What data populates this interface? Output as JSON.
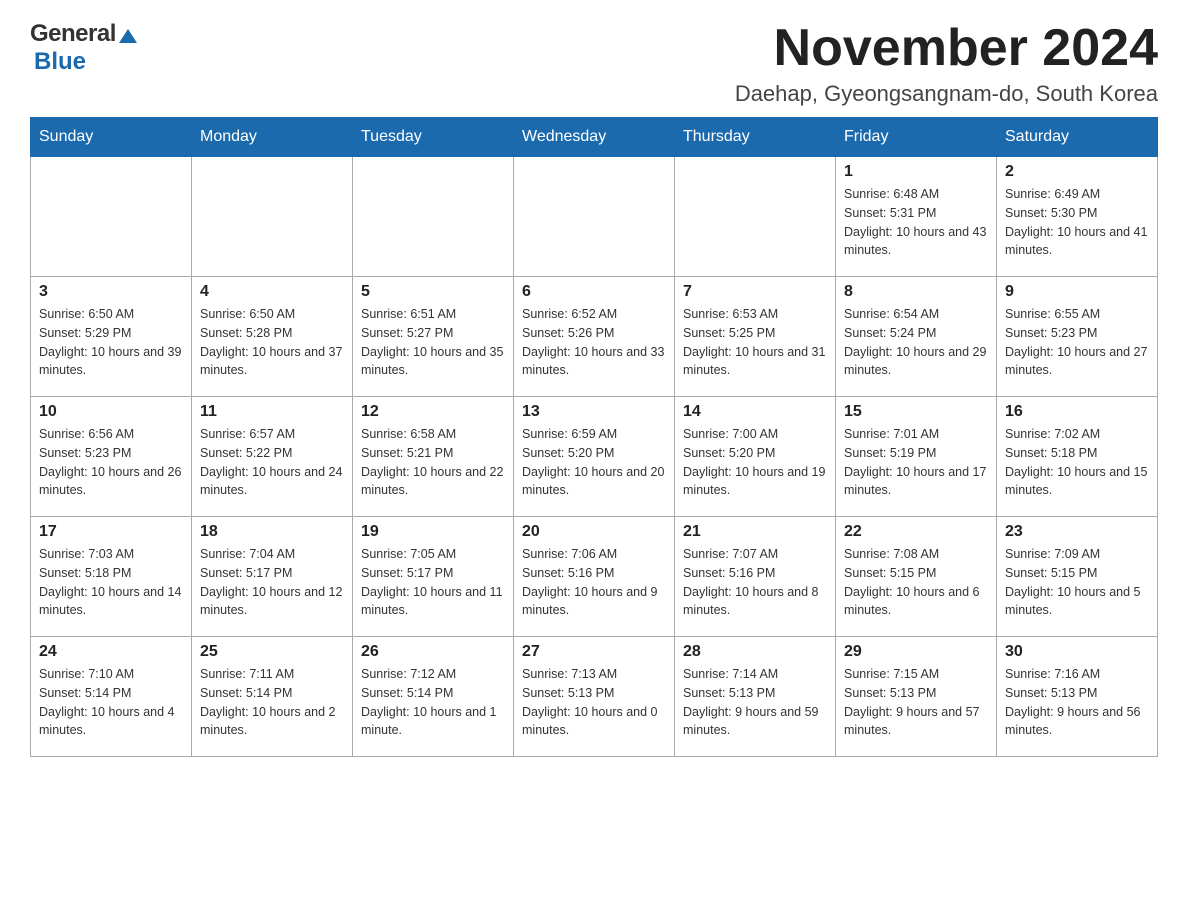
{
  "header": {
    "logo_general": "General",
    "logo_blue": "Blue",
    "title": "November 2024",
    "location": "Daehap, Gyeongsangnam-do, South Korea"
  },
  "days_of_week": [
    "Sunday",
    "Monday",
    "Tuesday",
    "Wednesday",
    "Thursday",
    "Friday",
    "Saturday"
  ],
  "weeks": [
    [
      {
        "day": "",
        "info": ""
      },
      {
        "day": "",
        "info": ""
      },
      {
        "day": "",
        "info": ""
      },
      {
        "day": "",
        "info": ""
      },
      {
        "day": "",
        "info": ""
      },
      {
        "day": "1",
        "info": "Sunrise: 6:48 AM\nSunset: 5:31 PM\nDaylight: 10 hours and 43 minutes."
      },
      {
        "day": "2",
        "info": "Sunrise: 6:49 AM\nSunset: 5:30 PM\nDaylight: 10 hours and 41 minutes."
      }
    ],
    [
      {
        "day": "3",
        "info": "Sunrise: 6:50 AM\nSunset: 5:29 PM\nDaylight: 10 hours and 39 minutes."
      },
      {
        "day": "4",
        "info": "Sunrise: 6:50 AM\nSunset: 5:28 PM\nDaylight: 10 hours and 37 minutes."
      },
      {
        "day": "5",
        "info": "Sunrise: 6:51 AM\nSunset: 5:27 PM\nDaylight: 10 hours and 35 minutes."
      },
      {
        "day": "6",
        "info": "Sunrise: 6:52 AM\nSunset: 5:26 PM\nDaylight: 10 hours and 33 minutes."
      },
      {
        "day": "7",
        "info": "Sunrise: 6:53 AM\nSunset: 5:25 PM\nDaylight: 10 hours and 31 minutes."
      },
      {
        "day": "8",
        "info": "Sunrise: 6:54 AM\nSunset: 5:24 PM\nDaylight: 10 hours and 29 minutes."
      },
      {
        "day": "9",
        "info": "Sunrise: 6:55 AM\nSunset: 5:23 PM\nDaylight: 10 hours and 27 minutes."
      }
    ],
    [
      {
        "day": "10",
        "info": "Sunrise: 6:56 AM\nSunset: 5:23 PM\nDaylight: 10 hours and 26 minutes."
      },
      {
        "day": "11",
        "info": "Sunrise: 6:57 AM\nSunset: 5:22 PM\nDaylight: 10 hours and 24 minutes."
      },
      {
        "day": "12",
        "info": "Sunrise: 6:58 AM\nSunset: 5:21 PM\nDaylight: 10 hours and 22 minutes."
      },
      {
        "day": "13",
        "info": "Sunrise: 6:59 AM\nSunset: 5:20 PM\nDaylight: 10 hours and 20 minutes."
      },
      {
        "day": "14",
        "info": "Sunrise: 7:00 AM\nSunset: 5:20 PM\nDaylight: 10 hours and 19 minutes."
      },
      {
        "day": "15",
        "info": "Sunrise: 7:01 AM\nSunset: 5:19 PM\nDaylight: 10 hours and 17 minutes."
      },
      {
        "day": "16",
        "info": "Sunrise: 7:02 AM\nSunset: 5:18 PM\nDaylight: 10 hours and 15 minutes."
      }
    ],
    [
      {
        "day": "17",
        "info": "Sunrise: 7:03 AM\nSunset: 5:18 PM\nDaylight: 10 hours and 14 minutes."
      },
      {
        "day": "18",
        "info": "Sunrise: 7:04 AM\nSunset: 5:17 PM\nDaylight: 10 hours and 12 minutes."
      },
      {
        "day": "19",
        "info": "Sunrise: 7:05 AM\nSunset: 5:17 PM\nDaylight: 10 hours and 11 minutes."
      },
      {
        "day": "20",
        "info": "Sunrise: 7:06 AM\nSunset: 5:16 PM\nDaylight: 10 hours and 9 minutes."
      },
      {
        "day": "21",
        "info": "Sunrise: 7:07 AM\nSunset: 5:16 PM\nDaylight: 10 hours and 8 minutes."
      },
      {
        "day": "22",
        "info": "Sunrise: 7:08 AM\nSunset: 5:15 PM\nDaylight: 10 hours and 6 minutes."
      },
      {
        "day": "23",
        "info": "Sunrise: 7:09 AM\nSunset: 5:15 PM\nDaylight: 10 hours and 5 minutes."
      }
    ],
    [
      {
        "day": "24",
        "info": "Sunrise: 7:10 AM\nSunset: 5:14 PM\nDaylight: 10 hours and 4 minutes."
      },
      {
        "day": "25",
        "info": "Sunrise: 7:11 AM\nSunset: 5:14 PM\nDaylight: 10 hours and 2 minutes."
      },
      {
        "day": "26",
        "info": "Sunrise: 7:12 AM\nSunset: 5:14 PM\nDaylight: 10 hours and 1 minute."
      },
      {
        "day": "27",
        "info": "Sunrise: 7:13 AM\nSunset: 5:13 PM\nDaylight: 10 hours and 0 minutes."
      },
      {
        "day": "28",
        "info": "Sunrise: 7:14 AM\nSunset: 5:13 PM\nDaylight: 9 hours and 59 minutes."
      },
      {
        "day": "29",
        "info": "Sunrise: 7:15 AM\nSunset: 5:13 PM\nDaylight: 9 hours and 57 minutes."
      },
      {
        "day": "30",
        "info": "Sunrise: 7:16 AM\nSunset: 5:13 PM\nDaylight: 9 hours and 56 minutes."
      }
    ]
  ]
}
